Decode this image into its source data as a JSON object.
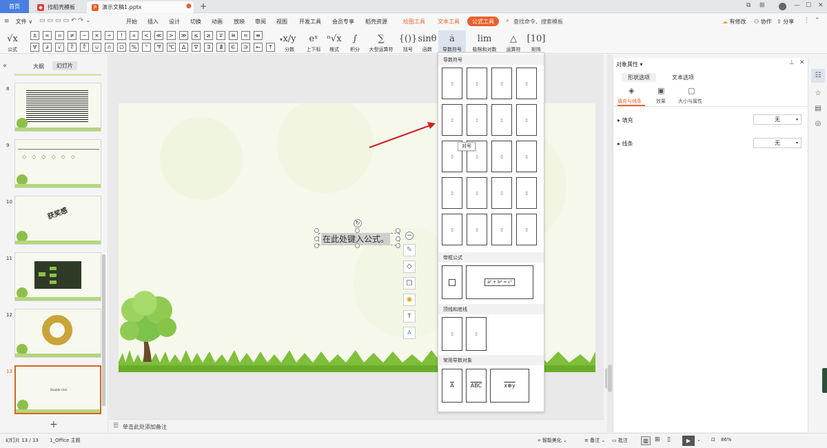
{
  "titlebar": {
    "tabs": [
      {
        "label": "首页"
      },
      {
        "label": "找稻壳模板"
      },
      {
        "label": "演示文稿1.pptx"
      }
    ],
    "new_tab": "+",
    "window_buttons": [
      "⧉",
      "⊞",
      "—",
      "☐",
      "✕"
    ]
  },
  "menubar": {
    "file_label": "文件",
    "items": [
      "开始",
      "插入",
      "设计",
      "切换",
      "动画",
      "放映",
      "审阅",
      "视图",
      "开发工具",
      "会员专享",
      "稻壳资源"
    ],
    "context_tabs": [
      "绘图工具",
      "文本工具",
      "公式工具"
    ],
    "search_placeholder": "查找命令、搜索模板",
    "right_items": [
      "有修改",
      "协作",
      "分享"
    ]
  },
  "ribbon": {
    "formula_label": "公式",
    "symbols_row1": [
      "±",
      "∞",
      "=",
      "≠",
      "~",
      "×",
      "÷",
      "!",
      "∝",
      "<",
      "≪",
      ">",
      "≫",
      "≤",
      "≥",
      "∓",
      "≅",
      "≈",
      "≡"
    ],
    "symbols_row2": [
      "∀",
      "∂",
      "√",
      "∛",
      "∜",
      "∪",
      "∩",
      "∅",
      "%",
      "°",
      "℉",
      "℃",
      "∆",
      "∇",
      "∃",
      "∄",
      "∈",
      "∋",
      "←",
      "↑"
    ],
    "buttons": [
      {
        "label": "分数",
        "glyph": "x/y"
      },
      {
        "label": "上下标",
        "glyph": "eˣ"
      },
      {
        "label": "根式",
        "glyph": "ⁿ√x"
      },
      {
        "label": "积分",
        "glyph": "∫"
      },
      {
        "label": "大型运算符",
        "glyph": "∑"
      },
      {
        "label": "括号",
        "glyph": "{()}"
      },
      {
        "label": "函数",
        "glyph": "sinθ"
      },
      {
        "label": "导数符号",
        "glyph": "ȧ"
      },
      {
        "label": "极限和对数",
        "glyph": "lim"
      },
      {
        "label": "运算符",
        "glyph": "△"
      },
      {
        "label": "矩阵",
        "glyph": "[10]"
      }
    ]
  },
  "left_panel": {
    "tabs": [
      "大纲",
      "幻灯片"
    ],
    "slide_numbers": [
      "8",
      "9",
      "10",
      "11",
      "12",
      "13"
    ],
    "slide10_text": "获奖感",
    "slide13_text": "Double-click",
    "add_slide": "+"
  },
  "slide": {
    "placeholder": "在此处键入公式。"
  },
  "notes": {
    "placeholder": "单击此处添加备注"
  },
  "formula_panel": {
    "sections": [
      "导数符号",
      "带框公式",
      "顶线和底线",
      "常用导数对象"
    ],
    "tooltip": "对号",
    "boxed_formula": "a² + b² = c²",
    "common_items": [
      "A",
      "ABC",
      "x⊕y"
    ]
  },
  "right_pane": {
    "title": "对象属性",
    "tabs": [
      "形状选项",
      "文本选项"
    ],
    "subtabs": [
      "填充与线条",
      "效果",
      "大小与属性"
    ],
    "fill": {
      "label": "填充",
      "value": "无"
    },
    "line": {
      "label": "线条",
      "value": "无"
    }
  },
  "statusbar": {
    "slide_info": "幻灯片 13 / 13",
    "theme": "1_Office 主题",
    "beautify": "智能美化",
    "notes": "备注",
    "comments": "批注",
    "zoom": "86%"
  },
  "colors": {
    "accent": "#e8612c",
    "home_tab": "#4a7fe0",
    "red_arrow": "#d02020"
  }
}
